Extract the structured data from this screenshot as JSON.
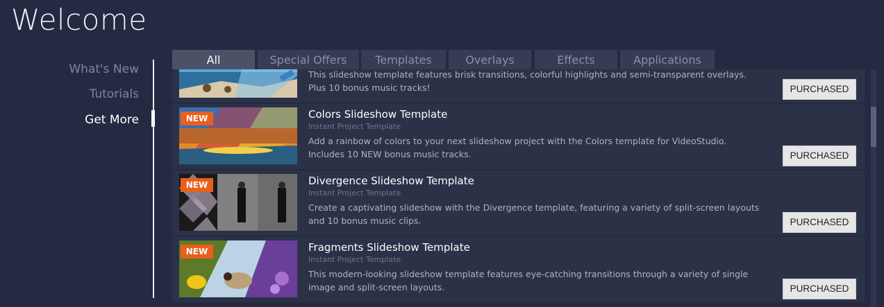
{
  "app": {
    "title": "Welcome"
  },
  "nav": {
    "items": [
      {
        "label": "What's New"
      },
      {
        "label": "Tutorials"
      },
      {
        "label": "Get More"
      }
    ],
    "active_index": 2
  },
  "tabs": [
    {
      "label": "All",
      "active": true
    },
    {
      "label": "Special Offers",
      "active": false
    },
    {
      "label": "Templates",
      "active": false
    },
    {
      "label": "Overlays",
      "active": false
    },
    {
      "label": "Effects",
      "active": false
    },
    {
      "label": "Applications",
      "active": false
    }
  ],
  "products": [
    {
      "title": "",
      "subtitle": "",
      "description": "This slideshow template features brisk transitions, colorful highlights and semi-transparent overlays. Plus 10 bonus music tracks!",
      "badge": "",
      "button": "PURCHASED"
    },
    {
      "title": "Colors Slideshow Template",
      "subtitle": "Instant Project Template",
      "description": "Add a rainbow of colors to your next slideshow project with the Colors template for VideoStudio. Includes 10 NEW bonus music tracks.",
      "badge": "NEW",
      "button": "PURCHASED"
    },
    {
      "title": "Divergence Slideshow Template",
      "subtitle": "Instant Project Template",
      "description": "Create a captivating slideshow with the Divergence template, featuring a variety of split-screen layouts and 10 bonus music clips.",
      "badge": "NEW",
      "button": "PURCHASED"
    },
    {
      "title": "Fragments Slideshow Template",
      "subtitle": "Instant Project Template",
      "description": "This modern-looking slideshow template features eye-catching transitions through a variety of single image and split-screen layouts.",
      "badge": "NEW",
      "button": "PURCHASED"
    }
  ]
}
